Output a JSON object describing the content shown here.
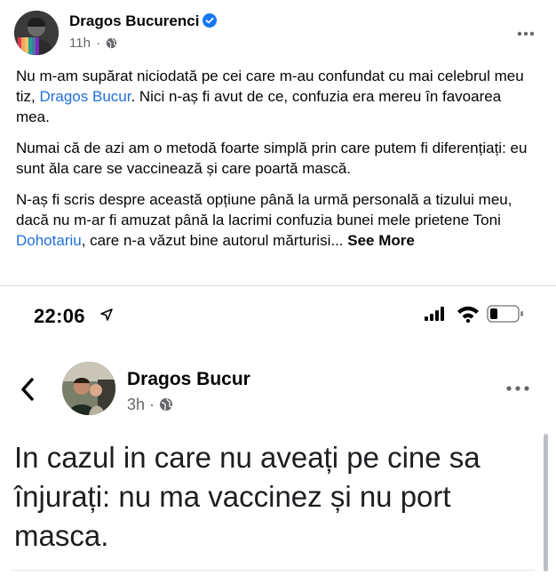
{
  "post": {
    "author": "Dragos Bucurenci",
    "time": "11h",
    "separator": "·",
    "paragraphs": {
      "p1_before": "Nu m-am supărat niciodată pe cei care m-au confundat cu mai celebrul meu tiz, ",
      "p1_link": "Dragos Bucur",
      "p1_after": ". Nici n-aș fi avut de ce, confuzia era mereu în favoarea mea.",
      "p2": "Numai că de azi am o metodă foarte simplă prin care putem fi diferențiați: eu sunt ăla care se vaccinează și care poartă mască.",
      "p3_before": "N-aș fi scris despre această opțiune până la urmă personală a tizului meu, dacă nu m-ar fi amuzat până la lacrimi confuzia bunei mele prietene Toni ",
      "p3_link": "Dohotariu",
      "p3_after": ", care n-a văzut bine autorul mărturisi... ",
      "see_more": "See More"
    }
  },
  "screenshot": {
    "status_time": "22:06",
    "author": "Dragos Bucur",
    "time": "3h",
    "separator": "·",
    "text": "In cazul in care nu aveați pe cine sa înjurați: nu ma vaccinez și nu port masca."
  },
  "colors": {
    "link": "#216fdb",
    "verified": "#1877f2",
    "meta": "#65676b"
  },
  "icons": [
    "verified-badge-icon",
    "globe-icon",
    "more-options-icon",
    "location-arrow-icon",
    "cellular-signal-icon",
    "wifi-icon",
    "battery-icon",
    "back-chevron-icon"
  ]
}
